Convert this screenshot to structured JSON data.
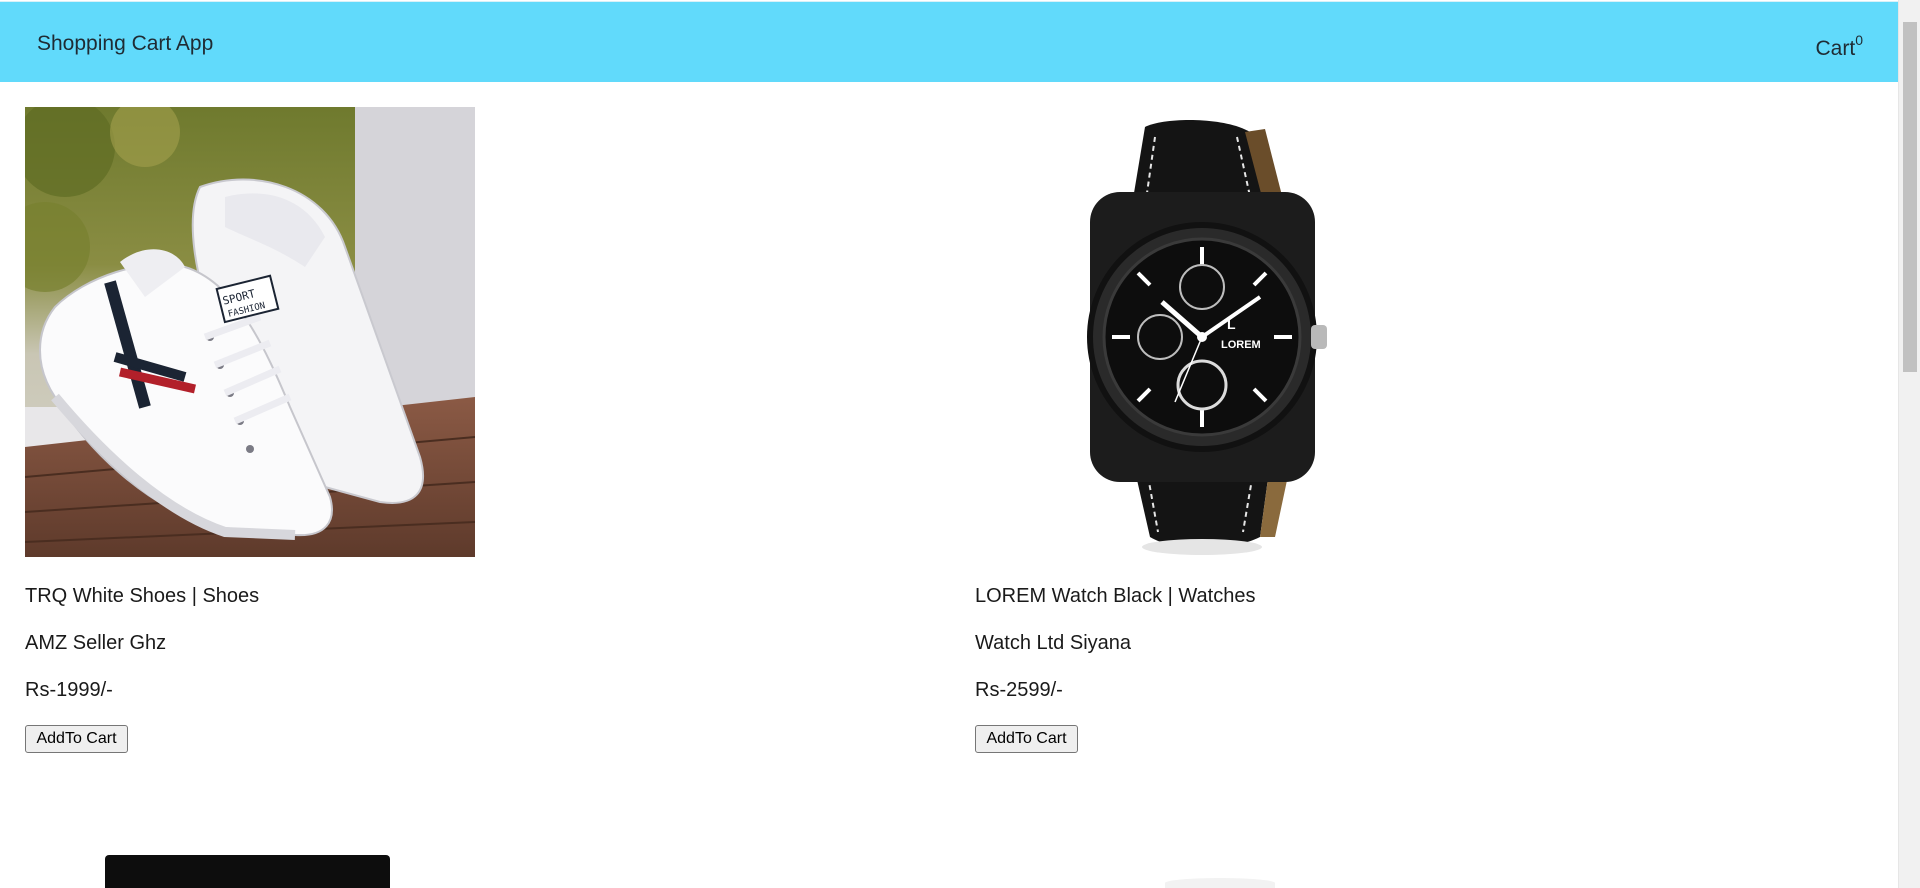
{
  "navbar": {
    "brand": "Shopping Cart App",
    "cart_label": "Cart",
    "cart_count": "0",
    "background_color": "#61dafb"
  },
  "products": [
    {
      "title": "TRQ White Shoes | Shoes",
      "seller": "AMZ Seller Ghz",
      "price": "Rs-1999/-",
      "button_label": "AddTo Cart",
      "image_icon": "white-sneakers-image"
    },
    {
      "title": "LOREM Watch Black | Watches",
      "seller": "Watch Ltd Siyana",
      "price": "Rs-2599/-",
      "button_label": "AddTo Cart",
      "image_icon": "black-wristwatch-image",
      "watch_brand": "LOREM"
    }
  ],
  "shoe_logo_text": "SPORT FASHION"
}
